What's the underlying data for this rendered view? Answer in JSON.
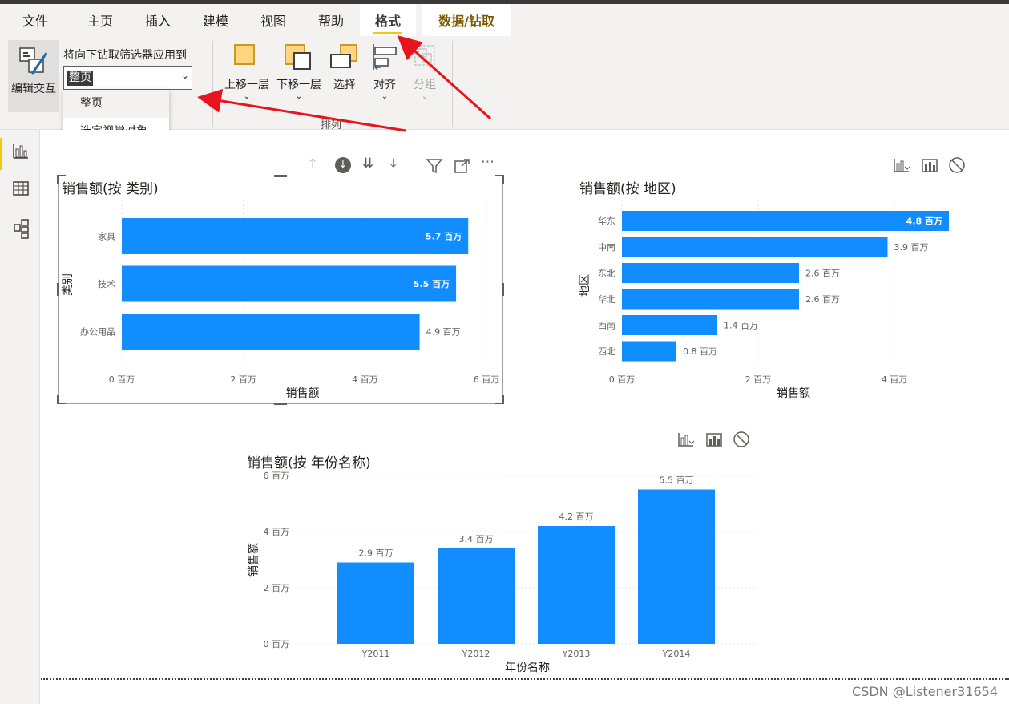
{
  "tabs": [
    "文件",
    "主页",
    "插入",
    "建模",
    "视图",
    "帮助",
    "格式",
    "数据/钻取"
  ],
  "ribbon": {
    "edit_interactions": "编辑交互",
    "drill_filter_label": "将向下钻取筛选器应用到",
    "drill_filter_value": "整页",
    "drill_filter_options": [
      "整页",
      "选定视觉对象"
    ],
    "bring_forward": "上移一层",
    "send_backward": "下移一层",
    "selection": "选择",
    "align": "对齐",
    "group": "分组",
    "arrange_group": "排列"
  },
  "colors": {
    "bar": "#118dff",
    "accent": "#f2c811",
    "annotation_arrow": "#e8141d"
  },
  "chart_data": [
    {
      "type": "bar",
      "orientation": "horizontal",
      "title": "销售额(按 类别)",
      "xlabel": "销售额",
      "ylabel": "类别",
      "categories": [
        "家具",
        "技术",
        "办公用品"
      ],
      "values": [
        5.7,
        5.5,
        4.9
      ],
      "data_labels": [
        "5.7 百万",
        "5.5 百万",
        "4.9 百万"
      ],
      "ticks": [
        "0 百万",
        "2 百万",
        "4 百万",
        "6 百万"
      ],
      "xlim": [
        0,
        6
      ]
    },
    {
      "type": "bar",
      "orientation": "horizontal",
      "title": "销售额(按 地区)",
      "xlabel": "销售额",
      "ylabel": "地区",
      "categories": [
        "华东",
        "中南",
        "东北",
        "华北",
        "西南",
        "西北"
      ],
      "values": [
        4.8,
        3.9,
        2.6,
        2.6,
        1.4,
        0.8
      ],
      "data_labels": [
        "4.8 百万",
        "3.9 百万",
        "2.6 百万",
        "2.6 百万",
        "1.4 百万",
        "0.8 百万"
      ],
      "ticks": [
        "0 百万",
        "2 百万",
        "4 百万"
      ],
      "xlim": [
        0,
        4.8
      ]
    },
    {
      "type": "bar",
      "orientation": "vertical",
      "title": "销售额(按 年份名称)",
      "xlabel": "年份名称",
      "ylabel": "销售额",
      "categories": [
        "Y2011",
        "Y2012",
        "Y2013",
        "Y2014"
      ],
      "values": [
        2.9,
        3.4,
        4.2,
        5.5
      ],
      "data_labels": [
        "2.9 百万",
        "3.4 百万",
        "4.2 百万",
        "5.5 百万"
      ],
      "ticks": [
        "0 百万",
        "2 百万",
        "4 百万",
        "6 百万"
      ],
      "ylim": [
        0,
        6
      ]
    }
  ],
  "watermark": "CSDN @Listener31654"
}
